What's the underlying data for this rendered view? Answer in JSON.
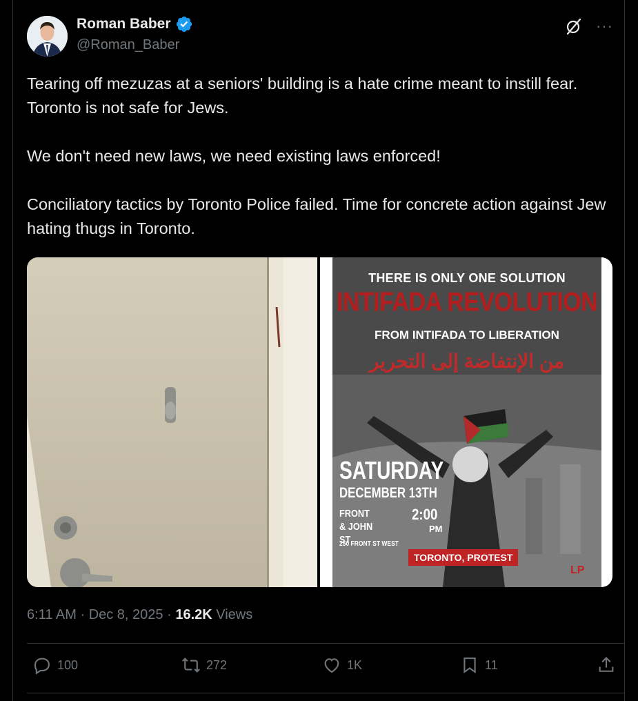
{
  "author": {
    "display_name": "Roman Baber",
    "handle": "@Roman_Baber"
  },
  "tweet": {
    "paragraphs": [
      "Tearing off mezuzas at a seniors' building is a hate crime meant to instill fear. Toronto is not safe for Jews.",
      "We don't need new laws, we need existing laws enforced!",
      "Conciliatory tactics by Toronto Police failed. Time for concrete action against Jew hating thugs in Toronto."
    ]
  },
  "poster": {
    "line1": "THERE IS ONLY ONE SOLUTION",
    "line2": "INTIFADA REVOLUTION",
    "line3": "FROM INTIFADA TO LIBERATION",
    "arabic": "من الإنتفاضة إلى التحرير",
    "day": "SATURDAY",
    "date": "DECEMBER 13TH",
    "location": "FRONT & JOHN ST",
    "time": "2:00",
    "ampm": "PM",
    "address": "250 FRONT ST WEST",
    "badge": "TORONTO, PROTEST"
  },
  "meta": {
    "time": "6:11 AM",
    "sep1": " · ",
    "date": "Dec 8, 2025",
    "sep2": " · ",
    "views_count": "16.2K",
    "views_label": " Views"
  },
  "actions": {
    "replies": "100",
    "reposts": "272",
    "likes": "1K",
    "bookmarks": "11"
  },
  "colors": {
    "background": "#000000",
    "text": "#e7e9ea",
    "muted": "#71767b",
    "verified": "#1d9bf0",
    "divider": "#2f3336"
  }
}
